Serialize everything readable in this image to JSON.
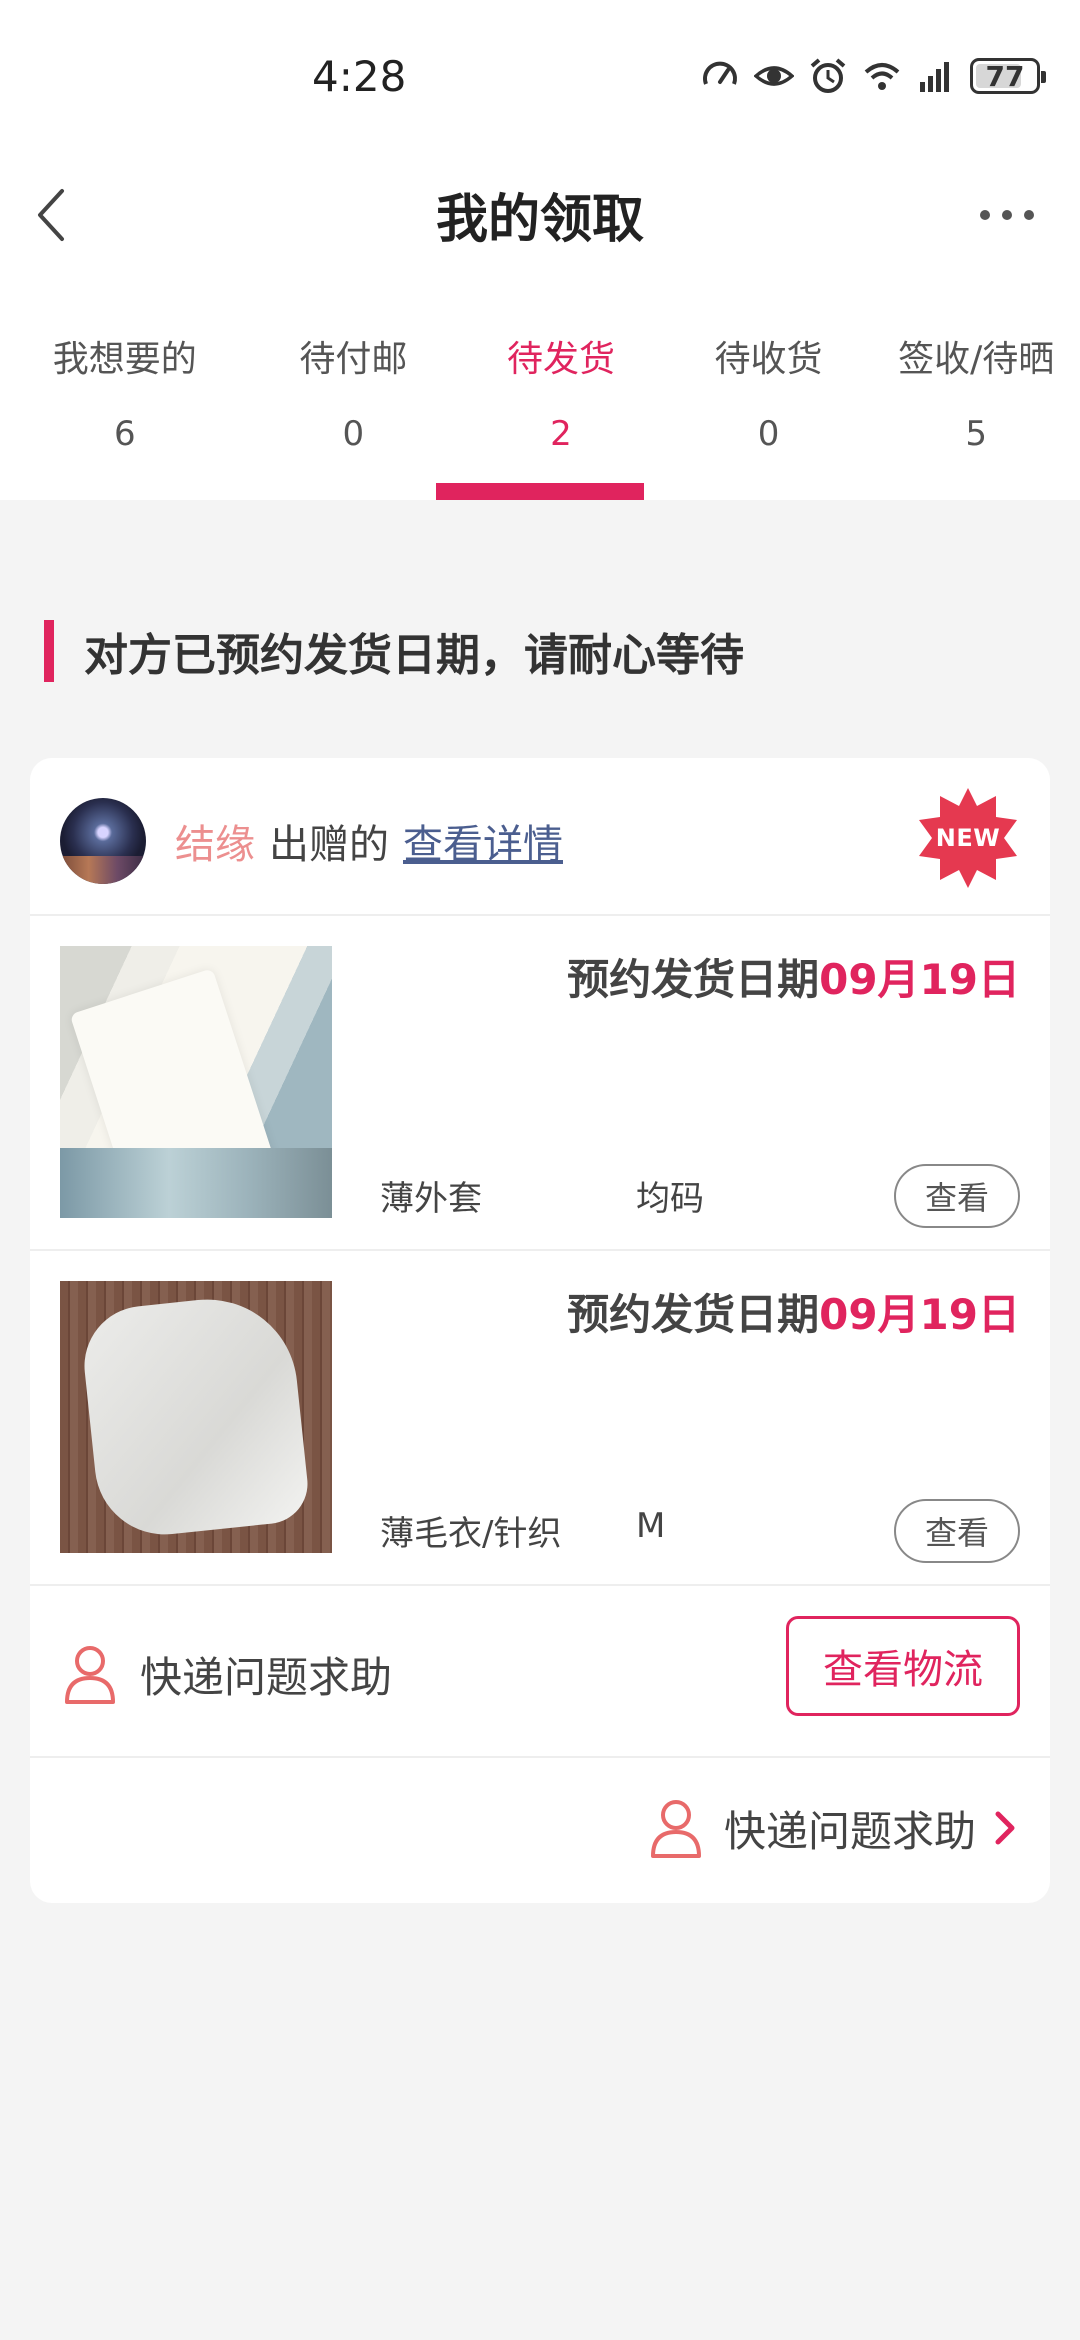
{
  "status_bar": {
    "time": "4:28",
    "battery": "77",
    "battery_level": 0.77
  },
  "header": {
    "title": "我的领取"
  },
  "tabs": [
    {
      "label": "我想要的",
      "count": "6"
    },
    {
      "label": "待付邮",
      "count": "0"
    },
    {
      "label": "待发货",
      "count": "2",
      "active": true
    },
    {
      "label": "待收货",
      "count": "0"
    },
    {
      "label": "签收/待晒",
      "count": "5"
    }
  ],
  "notice": {
    "text": "对方已预约发货日期，请耐心等待"
  },
  "card": {
    "giver_name": "结缘",
    "giver_suffix": "出赠的",
    "detail_link": "查看详情",
    "badge": "NEW",
    "items": [
      {
        "ship_label": "预约发货日期",
        "ship_date": "09月19日",
        "name": "薄外套",
        "size": "均码",
        "view_label": "查看"
      },
      {
        "ship_label": "预约发货日期",
        "ship_date": "09月19日",
        "name": "薄毛衣/针织",
        "size": "M",
        "view_label": "查看"
      }
    ],
    "help_text": "快递问题求助",
    "logistics_button": "查看物流",
    "footer_help_text": "快递问题求助"
  },
  "colors": {
    "accent": "#e0245e",
    "giver_name": "#ec8f8f",
    "link": "#4b5e8f",
    "background": "#f4f4f4"
  },
  "icons": [
    "back-arrow-icon",
    "more-icon",
    "speedometer-icon",
    "eye-icon",
    "alarm-icon",
    "wifi-icon",
    "signal-icon",
    "battery-icon",
    "new-badge-icon",
    "person-icon",
    "chevron-right-icon"
  ]
}
